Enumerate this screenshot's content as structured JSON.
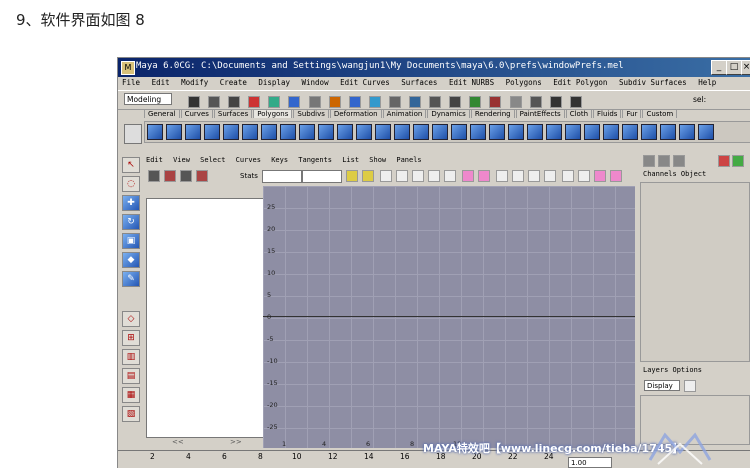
{
  "caption": "9、软件界面如图 8",
  "window": {
    "title": "Maya 6.0CG: C:\\Documents and Settings\\wangjun1\\My Documents\\maya\\6.0\\prefs\\windowPrefs.mel",
    "buttons": {
      "minimize": "_",
      "maximize": "□",
      "close": "×"
    }
  },
  "menubar": [
    "File",
    "Edit",
    "Modify",
    "Create",
    "Display",
    "Window",
    "Edit Curves",
    "Surfaces",
    "Edit NURBS",
    "Polygons",
    "Edit Polygon",
    "Subdiv Surfaces",
    "Help"
  ],
  "toolbar": {
    "mode": "Modeling",
    "sel_label": "sel:"
  },
  "shelf_tabs": [
    {
      "label": "General",
      "active": false
    },
    {
      "label": "Curves",
      "active": false
    },
    {
      "label": "Surfaces",
      "active": false
    },
    {
      "label": "Polygons",
      "active": true
    },
    {
      "label": "Subdivs",
      "active": false
    },
    {
      "label": "Deformation",
      "active": false
    },
    {
      "label": "Animation",
      "active": false
    },
    {
      "label": "Dynamics",
      "active": false
    },
    {
      "label": "Rendering",
      "active": false
    },
    {
      "label": "PaintEffects",
      "active": false
    },
    {
      "label": "Cloth",
      "active": false
    },
    {
      "label": "Fluids",
      "active": false
    },
    {
      "label": "Fur",
      "active": false
    },
    {
      "label": "Custom",
      "active": false
    }
  ],
  "panel_menu": [
    "Edit",
    "View",
    "Select",
    "Curves",
    "Keys",
    "Tangents",
    "List",
    "Show",
    "Panels"
  ],
  "panel_tools": {
    "stats_label": "Stats"
  },
  "outliner_footer": {
    "left": "<<",
    "right": ">>"
  },
  "graph": {
    "y_labels": [
      "25",
      "20",
      "15",
      "10",
      "5",
      "0",
      "-5",
      "-10",
      "-15",
      "-20",
      "-25"
    ],
    "x_labels": [
      "1",
      "4",
      "6",
      "8",
      "10"
    ]
  },
  "channel_box": {
    "header": "Channels Object"
  },
  "layers": {
    "header": "Layers Options",
    "display": "Display"
  },
  "timeline": {
    "labels": [
      "2",
      "4",
      "6",
      "8",
      "10",
      "12",
      "14",
      "16",
      "18",
      "20",
      "22",
      "24"
    ],
    "current_value": "1.00"
  },
  "watermark": "MAYA特效吧【www.linecg.com/tieba/1745】",
  "colors": {
    "title_bar": "#0a246a",
    "graph_bg": "#8e8ea4",
    "ui_gray": "#d4d0c8"
  }
}
